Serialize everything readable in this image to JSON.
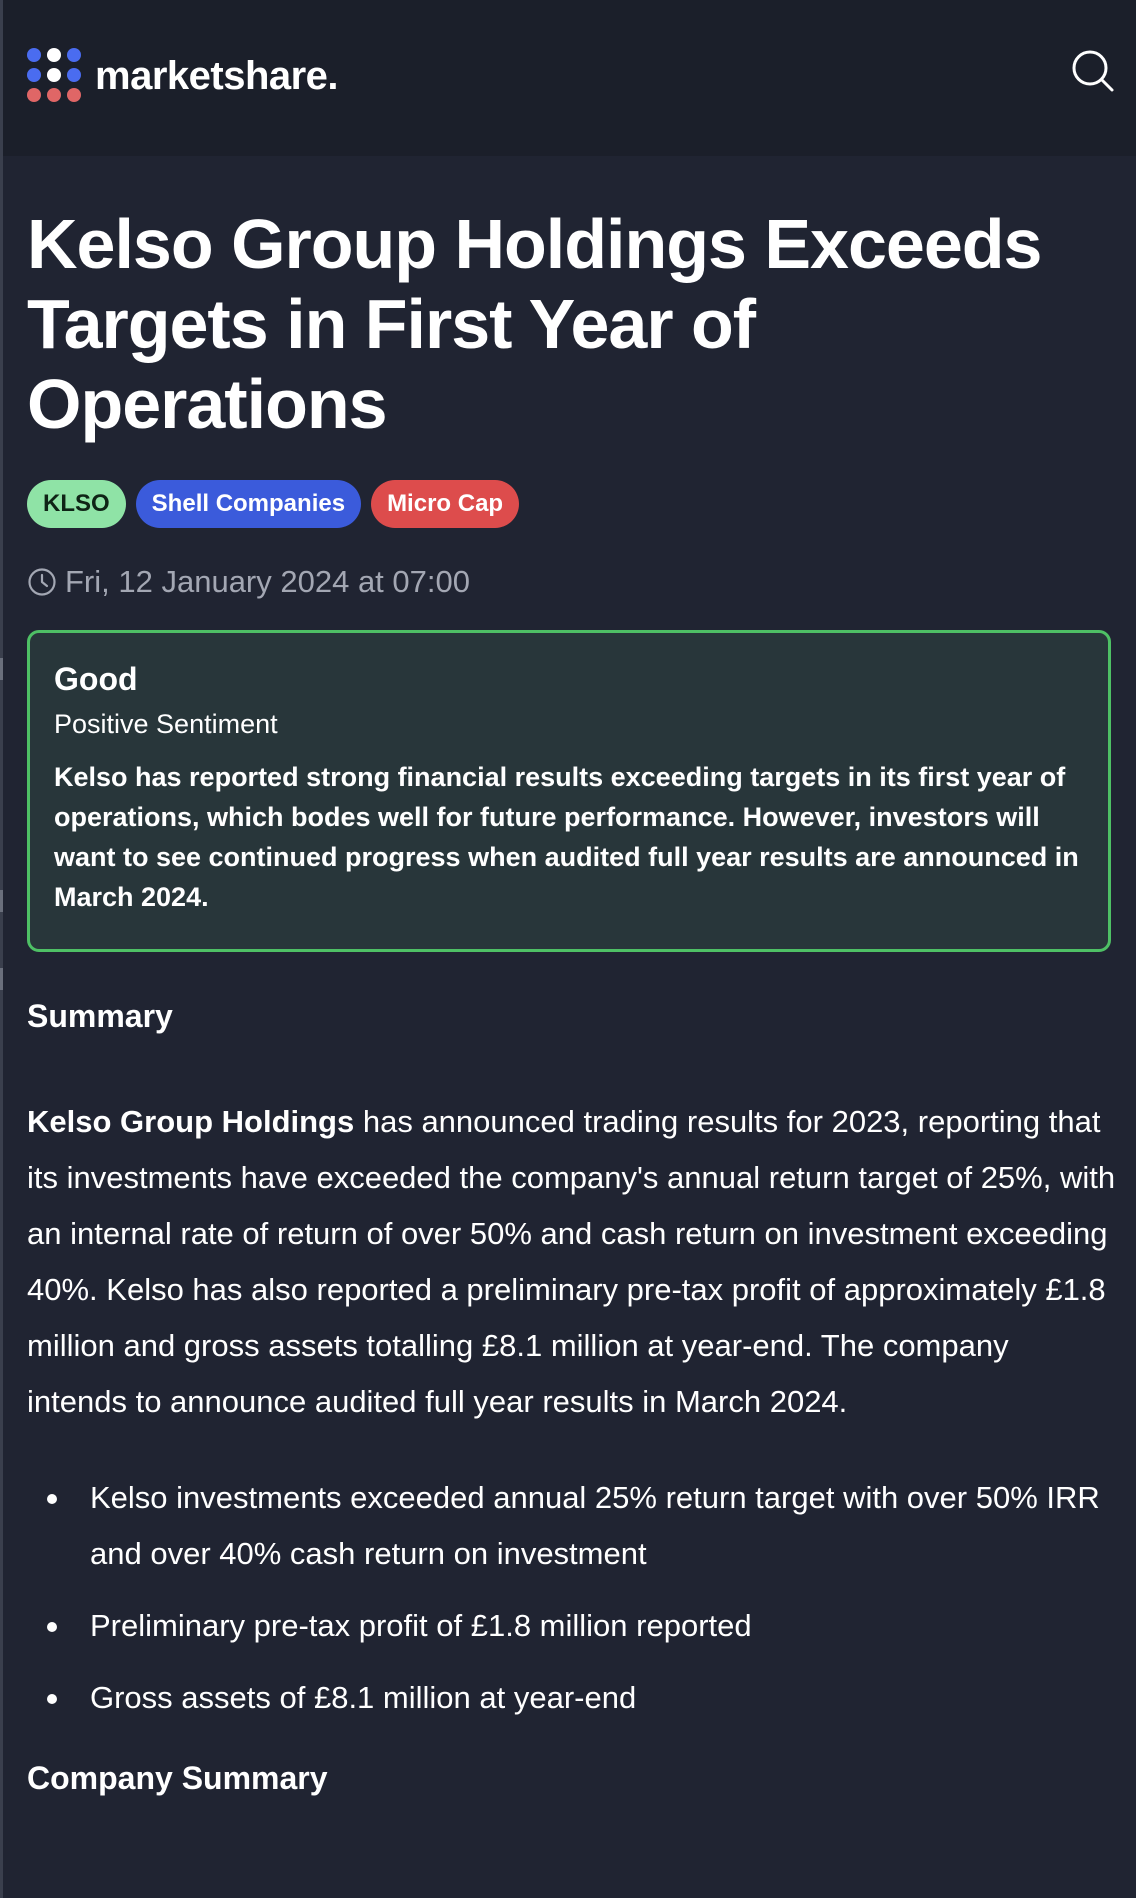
{
  "header": {
    "brand": "marketshare.",
    "logo_dot_colors": [
      "#4a6cf0",
      "#ffffff",
      "#4a6cf0",
      "#4a6cf0",
      "#ffffff",
      "#4a6cf0",
      "#e06666",
      "#e06666",
      "#e06666"
    ],
    "search_icon": "search-icon"
  },
  "article": {
    "title": "Kelso Group Holdings Exceeds Targets in First Year of Operations",
    "tags": [
      {
        "label": "KLSO",
        "color": "#8fe3a6"
      },
      {
        "label": "Shell Companies",
        "color": "#3b5bdb"
      },
      {
        "label": "Micro Cap",
        "color": "#dd4c4c"
      }
    ],
    "date": "Fri, 12 January 2024 at 07:00",
    "sentiment": {
      "rating": "Good",
      "label": "Positive Sentiment",
      "text": "Kelso has reported strong financial results exceeding targets in its first year of operations, which bodes well for future performance. However, investors will want to see continued progress when audited full year results are announced in March 2024.",
      "border_color": "#4ec065"
    },
    "summary_heading": "Summary",
    "summary_company": "Kelso Group Holdings",
    "summary_text": " has announced trading results for 2023, reporting that its investments have exceeded the company's annual return target of 25%, with an internal rate of return of over 50% and cash return on investment exceeding 40%. Kelso has also reported a preliminary pre-tax profit of approximately £1.8 million and gross assets totalling £8.1 million at year-end. The company intends to announce audited full year results in March 2024.",
    "bullets": [
      "Kelso investments exceeded annual 25% return target with over 50% IRR and over 40% cash return on investment",
      "Preliminary pre-tax profit of £1.8 million reported",
      "Gross assets of £8.1 million at year-end"
    ],
    "company_summary_heading": "Company Summary"
  }
}
